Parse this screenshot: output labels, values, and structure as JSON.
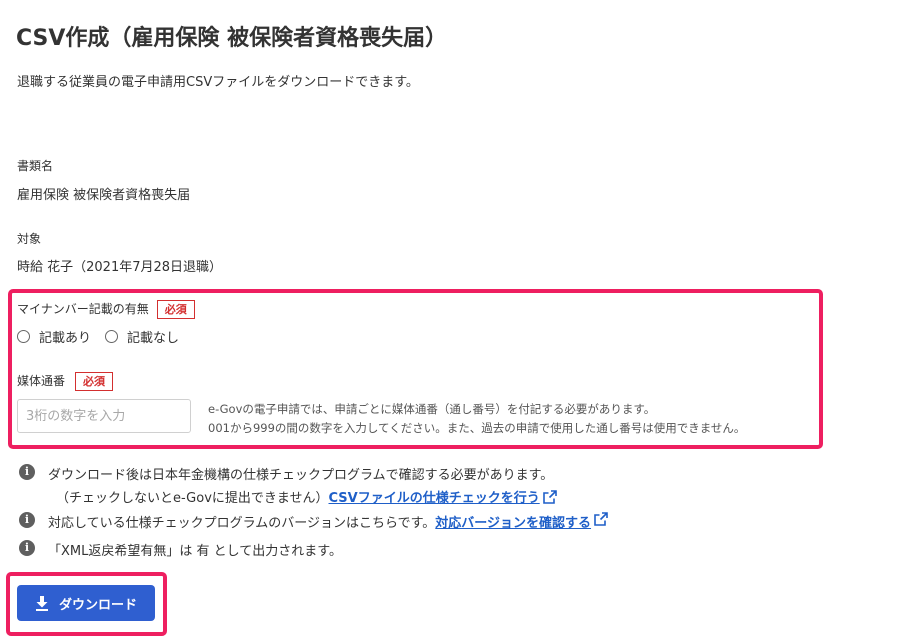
{
  "page": {
    "title": "CSV作成（雇用保険 被保険者資格喪失届）",
    "subtitle": "退職する従業員の電子申請用CSVファイルをダウンロードできます。"
  },
  "document": {
    "label": "書類名",
    "value": "雇用保険 被保険者資格喪失届"
  },
  "target": {
    "label": "対象",
    "value": "時給 花子（2021年7月28日退職）"
  },
  "mynumber": {
    "label": "マイナンバー記載の有無",
    "required_badge": "必須",
    "options": [
      "記載あり",
      "記載なし"
    ]
  },
  "media_serial": {
    "label": "媒体通番",
    "required_badge": "必須",
    "placeholder": "3桁の数字を入力",
    "hint_line1": "e-Govの電子申請では、申請ごとに媒体通番（通し番号）を付記する必要があります。",
    "hint_line2": "001から999の間の数字を入力してください。また、過去の申請で使用した通し番号は使用できません。"
  },
  "notices": {
    "n1_line1": "ダウンロード後は日本年金機構の仕様チェックプログラムで確認する必要があります。",
    "n1_line2": "（チェックしないとe-Govに提出できません）",
    "n1_link": "CSVファイルの仕様チェックを行う",
    "n2_text": "対応している仕様チェックプログラムのバージョンはこちらです。",
    "n2_link": "対応バージョンを確認する",
    "n3_text": "「XML返戻希望有無」は 有 として出力されます。"
  },
  "download": {
    "label": "ダウンロード"
  },
  "colors": {
    "highlight": "#ee1f60",
    "primary": "#2f5fd0",
    "link": "#1f5fc8",
    "required": "#d32f2f"
  },
  "icons": {
    "info": "info-icon",
    "external_link": "external-link-icon",
    "download": "download-icon"
  }
}
